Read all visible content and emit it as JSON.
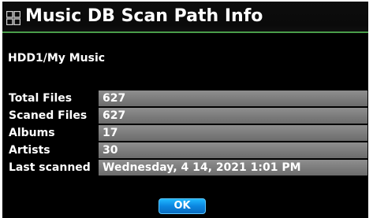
{
  "dialog": {
    "title": "Music DB Scan Path Info",
    "path": "HDD1/My Music"
  },
  "info_rows": [
    {
      "label": "Total Files",
      "value": "627"
    },
    {
      "label": "Scaned Files",
      "value": "627"
    },
    {
      "label": "Albums",
      "value": "17"
    },
    {
      "label": "Artists",
      "value": "30"
    },
    {
      "label": "Last scanned",
      "value": "Wednesday, 4 14, 2021 1:01 PM"
    }
  ],
  "buttons": {
    "ok_label": "OK"
  },
  "colors": {
    "background": "#000000",
    "title_underline": "#4a9e4a",
    "value_bar": "#7b7b7b",
    "button": "#0b86e0",
    "text": "#ffffff"
  },
  "icons": {
    "title": "music-library-grid-icon"
  }
}
